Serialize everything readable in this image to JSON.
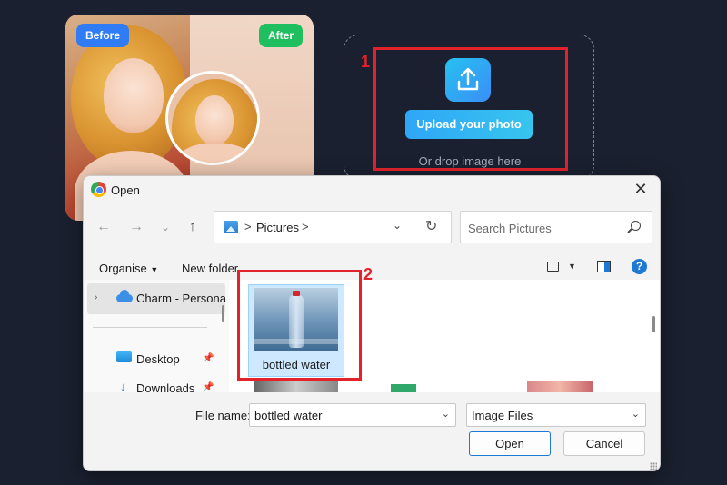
{
  "before_after": {
    "before_label": "Before",
    "after_label": "After"
  },
  "upload": {
    "button_label": "Upload your photo",
    "drop_text": "Or drop image here",
    "icon": "upload-icon"
  },
  "annotations": [
    {
      "number": "1"
    },
    {
      "number": "2"
    }
  ],
  "dialog": {
    "title": "Open",
    "address": {
      "separator": ">",
      "location": "Pictures",
      "trailing_separator": ">"
    },
    "search_placeholder": "Search Pictures",
    "toolbar": {
      "organise_label": "Organise",
      "new_folder_label": "New folder",
      "help_label": "?"
    },
    "sidebar": {
      "items": [
        {
          "label": "Charm - Persona",
          "icon": "cloud-icon"
        },
        {
          "label": "Desktop",
          "icon": "desktop-icon"
        },
        {
          "label": "Downloads",
          "icon": "download-icon"
        }
      ]
    },
    "files": [
      {
        "name": "bottled water",
        "selected": true
      }
    ],
    "file_name_label": "File name:",
    "file_name_value": "bottled water",
    "file_type_value": "Image Files",
    "open_button": "Open",
    "cancel_button": "Cancel"
  },
  "colors": {
    "page_background": "#1b2030",
    "accent_blue": "#1e79d6",
    "annotation_red": "#e2232c",
    "before_badge": "#2f7cf6",
    "after_badge": "#1fbf5f"
  }
}
